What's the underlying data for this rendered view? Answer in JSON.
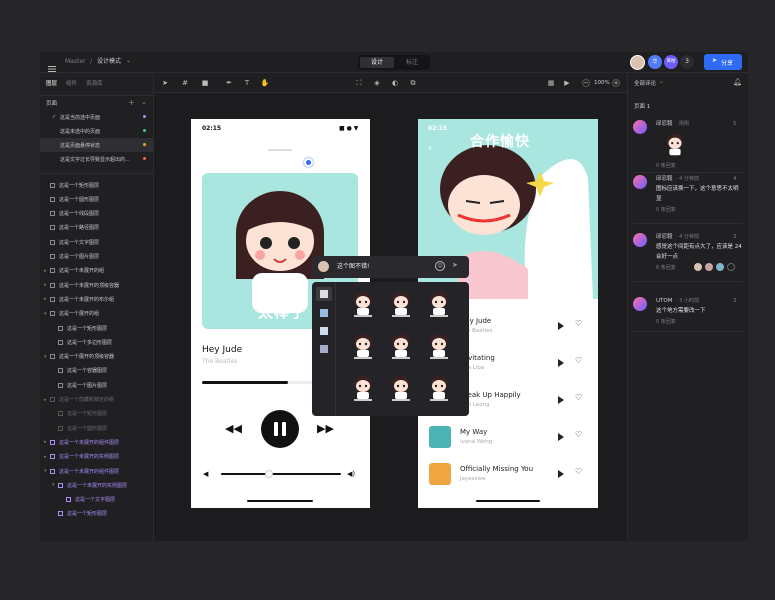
{
  "topbar": {
    "breadcrumb_root": "Master",
    "breadcrumb_sep": "/",
    "breadcrumb_current": "设计模式",
    "mode_tabs": [
      "设计",
      "标注"
    ],
    "avatar_badges": [
      "华",
      "黄柏"
    ],
    "viewer_count": "3",
    "share_label": "分享"
  },
  "left": {
    "tabs": [
      "图层",
      "组件",
      "资源库"
    ],
    "pages_title": "页面",
    "pages": [
      {
        "label": "这是当前选中页面",
        "dot": "#a98cf5",
        "check": "✓"
      },
      {
        "label": "这是未选中的页面",
        "dot": "#3ec98a"
      },
      {
        "label": "这是页面悬停状态",
        "dot": "#f5a623"
      },
      {
        "label": "这是文字过长导致显示超出的...",
        "dot": "#f56c3e"
      }
    ],
    "layers": [
      {
        "label": "这是一个矩形图层",
        "indent": 0,
        "arrow": ""
      },
      {
        "label": "这是一个圆形图层",
        "indent": 0,
        "arrow": ""
      },
      {
        "label": "这是一个线段图层",
        "indent": 0,
        "arrow": ""
      },
      {
        "label": "这是一个路径图层",
        "indent": 0,
        "arrow": ""
      },
      {
        "label": "这是一个文字图层",
        "indent": 0,
        "arrow": ""
      },
      {
        "label": "这是一个图片图层",
        "indent": 0,
        "arrow": ""
      },
      {
        "label": "这是一个未展开的组",
        "indent": 0,
        "arrow": "▸"
      },
      {
        "label": "这是一个未展开的顶级容器",
        "indent": 0,
        "arrow": "▸"
      },
      {
        "label": "这是一个未展开的布尔组",
        "indent": 0,
        "arrow": "▸"
      },
      {
        "label": "这是一个展开的组",
        "indent": 0,
        "arrow": "▾"
      },
      {
        "label": "这是一个矩形图层",
        "indent": 1,
        "arrow": ""
      },
      {
        "label": "这是一个多边形图层",
        "indent": 1,
        "arrow": ""
      },
      {
        "label": "这是一个展开的顶级容器",
        "indent": 0,
        "arrow": "▾"
      },
      {
        "label": "这是一个容器图层",
        "indent": 1,
        "arrow": ""
      },
      {
        "label": "这是一个图片图层",
        "indent": 1,
        "arrow": ""
      },
      {
        "label": "这是一个隐藏和锁定的组",
        "indent": 0,
        "arrow": "▸",
        "dim": true
      },
      {
        "label": "这是一个矩形图层",
        "indent": 1,
        "arrow": "",
        "dim": true
      },
      {
        "label": "这是一个圆形图层",
        "indent": 1,
        "arrow": "",
        "dim": true
      },
      {
        "label": "这是一个未展开的组件图层",
        "indent": 0,
        "arrow": "▸",
        "purple": true
      },
      {
        "label": "这是一个未展开的实例图层",
        "indent": 0,
        "arrow": "▸",
        "purple": true
      },
      {
        "label": "这是一个未展开的组件图层",
        "indent": 0,
        "arrow": "▾",
        "purple": true
      },
      {
        "label": "这是一个未展开的实例图层",
        "indent": 1,
        "arrow": "▾",
        "purple": true
      },
      {
        "label": "这是一个文字图层",
        "indent": 2,
        "arrow": "",
        "purple": true
      },
      {
        "label": "这是一个矩形图层",
        "indent": 1,
        "arrow": "",
        "purple": true
      }
    ]
  },
  "toolbar": {
    "zoom": "100%",
    "zoom_minus": "−",
    "zoom_plus": "+"
  },
  "phone1": {
    "time": "02:15",
    "banner_text": "太棒了",
    "song_title": "Hey Jude",
    "song_artist": "The Beatles",
    "progress": 0.55,
    "volume": 0.4
  },
  "phone2": {
    "time": "02:15",
    "banner_text": "合作愉快",
    "songs": [
      {
        "name": "Hey Jude",
        "artist": "The Beatles",
        "color": "#c94b4b"
      },
      {
        "name": "Levitating",
        "artist": "Dua Lipa",
        "color": "#d8a54a"
      },
      {
        "name": "Break Up Happily",
        "artist": "Dan Leong",
        "color": "#7b6cc9"
      },
      {
        "name": "My Way",
        "artist": "Ivana Wong",
        "color": "#4bb3b3"
      },
      {
        "name": "Officially Missing You",
        "artist": "Jayesslee",
        "color": "#f0a640"
      }
    ]
  },
  "popup": {
    "input_value": "这个图不错!",
    "send_icon": "send-icon"
  },
  "right": {
    "filter_label": "全部评论",
    "page_label": "页面 1",
    "comments": [
      {
        "author": "邱忍毅",
        "time": "· 刚刚",
        "num": "5",
        "text": "",
        "replies": "0 条回复"
      },
      {
        "author": "邱忍毅",
        "time": "· 4 分钟前",
        "num": "4",
        "text": "图标应该换一下，这个意思不太明显",
        "replies": "0 条回复"
      },
      {
        "author": "邱忍毅",
        "time": "· 4 分钟前",
        "num": "3",
        "text": "感觉这个间距有点大了，应该是 24 会好一点",
        "replies": "6 条回复"
      },
      {
        "author": "UTOM",
        "time": "· 3 小时前",
        "num": "2",
        "text": "这个地方需要改一下",
        "replies": "0 条回复"
      }
    ]
  }
}
